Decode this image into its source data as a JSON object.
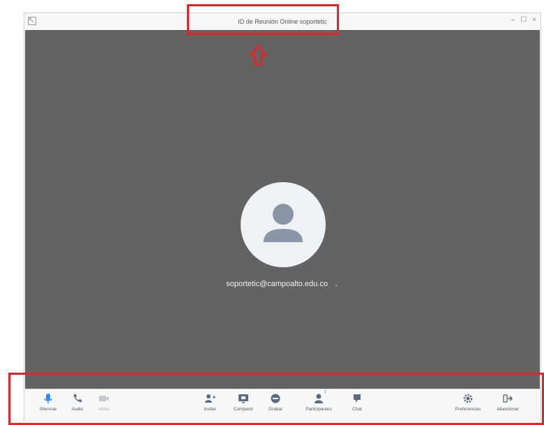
{
  "window": {
    "title": "ID de Reunión Online soportetic",
    "controls": {
      "minimize": "–",
      "maximize": "☐",
      "close": "×"
    }
  },
  "participant": {
    "name": "soportetic@campoalto.edu.co",
    "caret": "⌄"
  },
  "toolbar": {
    "mute": "Silenciar",
    "audio": "Audio",
    "video": "Video",
    "invite": "Invitar",
    "share": "Compartir",
    "record": "Grabar",
    "participants": "Participantes",
    "participants_count": "1",
    "chat": "Chat",
    "preferences": "Preferencias",
    "leave": "Abandonar"
  },
  "colors": {
    "accent": "#2d8cff",
    "highlight": "#e5232a",
    "video_bg": "#636363",
    "icon_gray": "#8a96a8"
  }
}
